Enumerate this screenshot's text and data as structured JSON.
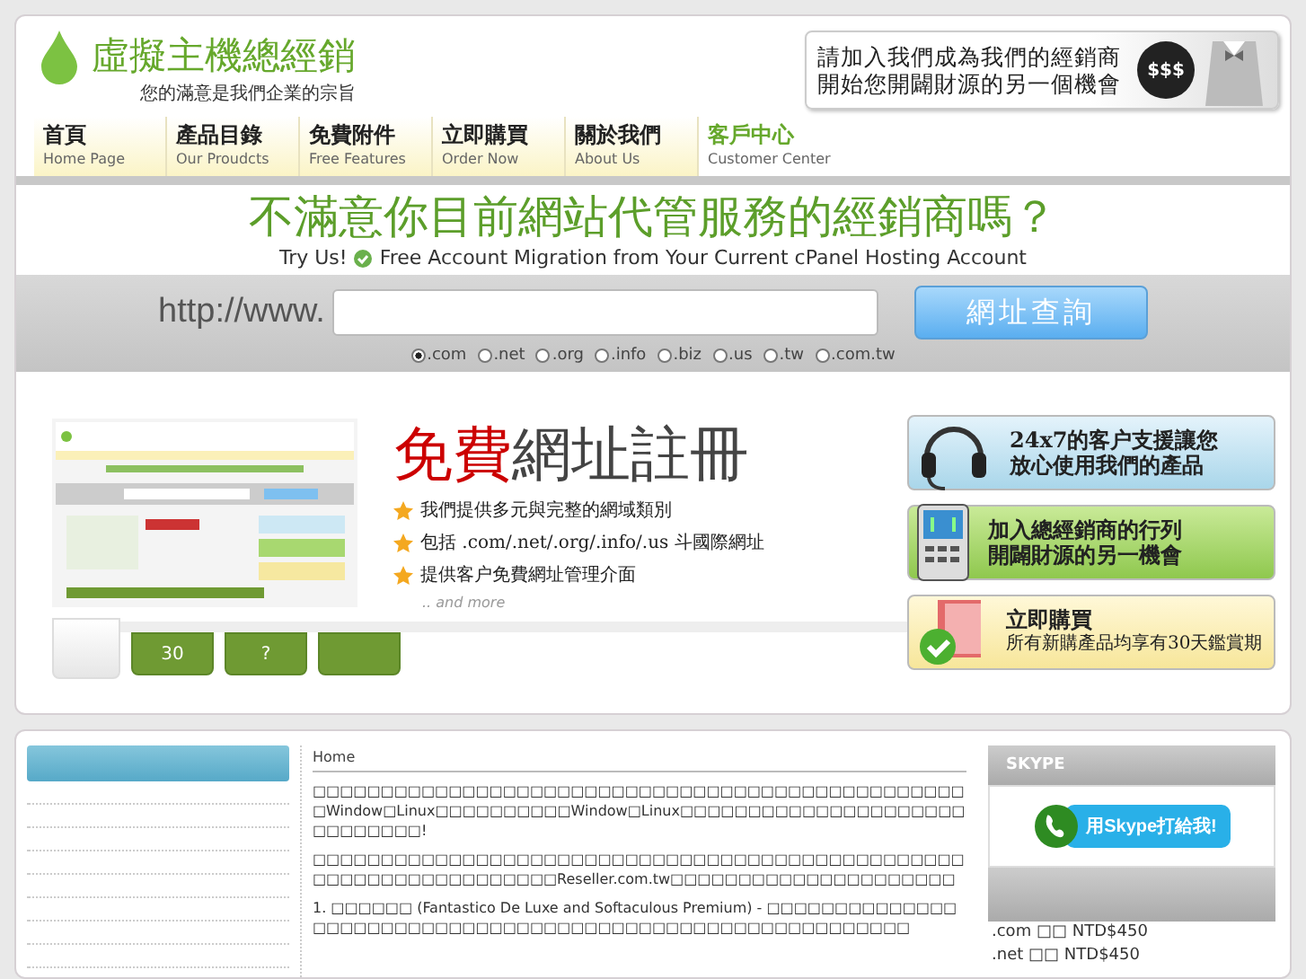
{
  "header": {
    "logo_title": "虛擬主機總經銷",
    "logo_slogan": "您的滿意是我們企業的宗旨",
    "ad_lines": [
      "請加入我們成為我們的經銷商",
      "開始您開闢財源的另一個機會"
    ],
    "ad_badge": "$$$"
  },
  "nav": [
    {
      "zh": "首頁",
      "en": "Home Page",
      "selected": false
    },
    {
      "zh": "產品目錄",
      "en": "Our Proudcts",
      "selected": false
    },
    {
      "zh": "免費附件",
      "en": "Free Features",
      "selected": false
    },
    {
      "zh": "立即購買",
      "en": "Order Now",
      "selected": false
    },
    {
      "zh": "關於我們",
      "en": "About Us",
      "selected": false
    },
    {
      "zh": "客戶中心",
      "en": "Customer Center",
      "selected": true
    }
  ],
  "headline": {
    "title": "不滿意你目前網站代管服務的經銷商嗎？",
    "try": "Try Us!",
    "migration": "Free Account Migration from Your Current cPanel Hosting Account"
  },
  "search": {
    "prefix": "http://www.",
    "button": "網址查詢",
    "domains": [
      {
        "label": ".com",
        "selected": true
      },
      {
        "label": ".net",
        "selected": false
      },
      {
        "label": ".org",
        "selected": false
      },
      {
        "label": ".info",
        "selected": false
      },
      {
        "label": ".biz",
        "selected": false
      },
      {
        "label": ".us",
        "selected": false
      },
      {
        "label": ".tw",
        "selected": false
      },
      {
        "label": ".com.tw",
        "selected": false
      }
    ]
  },
  "banner": {
    "title_red": "免費",
    "title_dark": "網址註冊",
    "bullets": [
      "我們提供多元與完整的網域類別",
      "包括 .com/.net/.org/.info/.us 斗國際網址",
      "提供客户免費網址管理介面"
    ],
    "more": ".. and more",
    "slides": [
      {
        "selected": true
      },
      {
        "label": "30",
        "selected": false
      },
      {
        "label": "?",
        "selected": false
      },
      {
        "selected": false
      }
    ]
  },
  "promos": [
    {
      "kind": "support",
      "lines": [
        "24x7的客户支援讓您",
        "放心使用我們的產品"
      ]
    },
    {
      "kind": "reseller",
      "lines": [
        "加入總經銷商的行列",
        "開闢財源的另一機會"
      ]
    },
    {
      "kind": "order",
      "lines": [
        "立即購買"
      ],
      "note": "所有新購產品均享有30天鑑賞期"
    }
  ],
  "breadcrumb": "Home",
  "paragraphs": [
    "□□□□□□□□□□□□□□□□□□□□□□□□□□□□□□□□□□□□□□□□□□□□□□□□□Window□Linux□□□□□□□□□□Window□Linux□□□□□□□□□□□□□□□□□□□□□□□□□□□□□!",
    "□□□□□□□□□□□□□□□□□□□□□□□□□□□□□□□□□□□□□□□□□□□□□□□□□□□□□□□□□□□□□□□□□□Reseller.com.tw□□□□□□□□□□□□□□□□□□□□□",
    "1. □□□□□□ (Fantastico De Luxe and Softaculous Premium) - □□□□□□□□□□□□□□□□□□□□□□□□□□□□□□□□□□□□□□□□□□□□□□□□□□□□□□□□□□"
  ],
  "skype": {
    "title": "SKYPE",
    "button": "用Skype打給我!"
  },
  "prices": [
    {
      "tld": ".com",
      "word": "□□",
      "price": "NTD$450"
    },
    {
      "tld": ".net",
      "word": "□□",
      "price": "NTD$450"
    }
  ]
}
